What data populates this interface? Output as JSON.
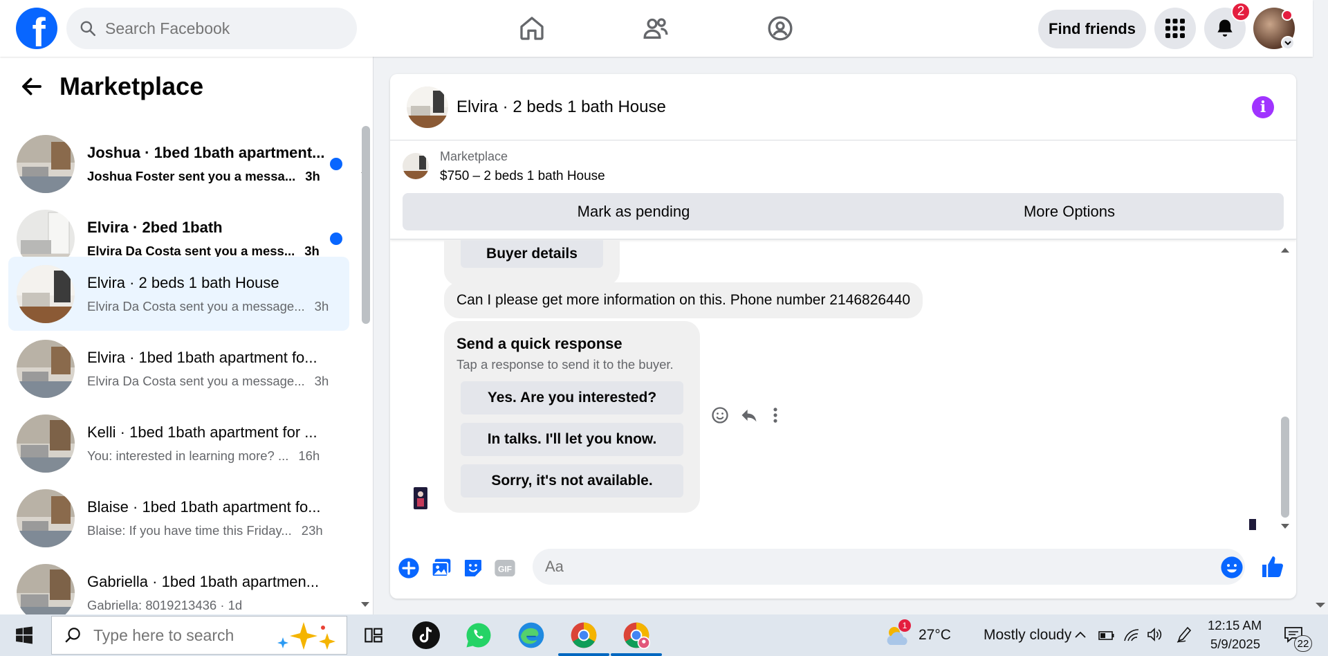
{
  "topbar": {
    "logo": "f",
    "search_placeholder": "Search Facebook",
    "find_friends": "Find friends",
    "notification_count": "2"
  },
  "sidebar": {
    "title": "Marketplace",
    "threads": [
      {
        "title": "Joshua · 1bed 1bath apartment...",
        "message": "Joshua Foster sent you a messa...",
        "time": "3h"
      },
      {
        "title": "Elvira · 2bed 1bath",
        "message": "Elvira Da Costa sent you a mess...",
        "time": "3h"
      },
      {
        "title": "Elvira · 2 beds 1 bath House",
        "message": "Elvira Da Costa sent you a message...",
        "time": "3h"
      },
      {
        "title": "Elvira · 1bed 1bath apartment fo...",
        "message": "Elvira Da Costa sent you a message...",
        "time": "3h"
      },
      {
        "title": "Kelli · 1bed 1bath apartment for ...",
        "message": "You: interested in learning more? ...",
        "time": "16h"
      },
      {
        "title": "Blaise · 1bed 1bath apartment fo...",
        "message": "Blaise: If you have time this Friday...",
        "time": "23h"
      },
      {
        "title": "Gabriella · 1bed 1bath apartmen...",
        "message": "Gabriella: 8019213436 · 1d",
        "time": ""
      }
    ]
  },
  "chat": {
    "title": "Elvira · 2 beds 1 bath House",
    "listing_source": "Marketplace",
    "listing_price": "$750 – 2 beds 1 bath House",
    "mark_pending": "Mark as pending",
    "more_options": "More Options",
    "buyer_details": "Buyer details",
    "message": "Can I please get more information on this. Phone number 2146826440",
    "quick_title": "Send a quick response",
    "quick_sub": "Tap a response to send it to the buyer.",
    "quick_responses": [
      "Yes. Are you interested?",
      "In talks. I'll let you know.",
      "Sorry, it's not available."
    ],
    "composer_placeholder": "Aa"
  },
  "taskbar": {
    "search_placeholder": "Type here to search",
    "weather_badge": "1",
    "temperature": "27°C",
    "weather": "Mostly cloudy",
    "time": "12:15 AM",
    "date": "5/9/2025",
    "notif_count": "22"
  },
  "colors": {
    "brand": "#0866ff",
    "active_thread": "#ebf5ff",
    "info": "#a033ff",
    "badge": "#e41e3f"
  }
}
